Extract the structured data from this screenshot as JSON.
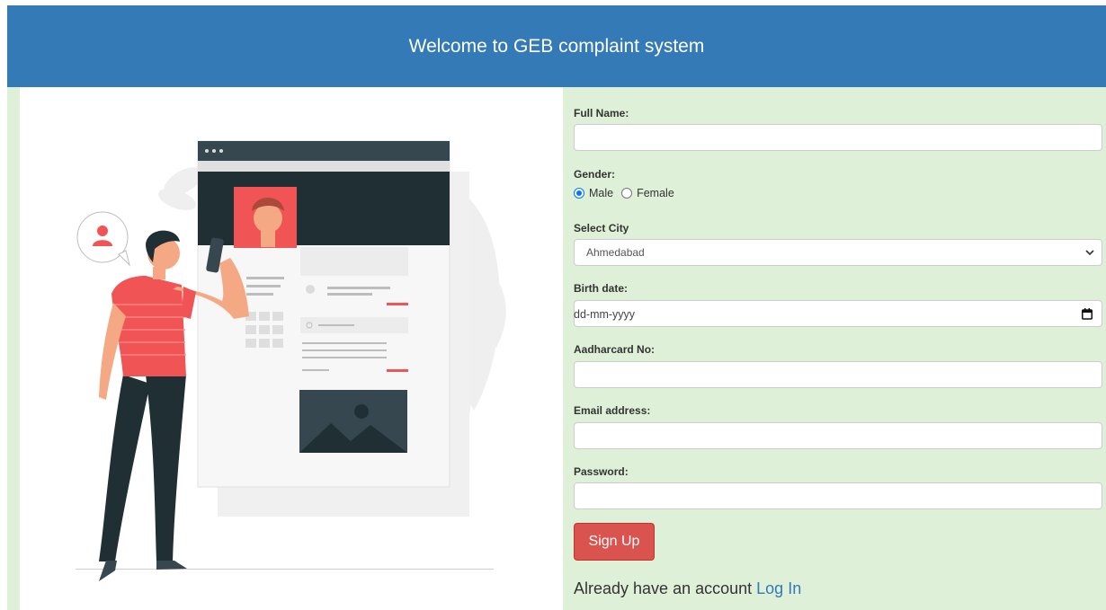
{
  "header": {
    "title": "Welcome to GEB complaint system"
  },
  "form": {
    "full_name": {
      "label": "Full Name:",
      "value": ""
    },
    "gender": {
      "label": "Gender:",
      "options": [
        "Male",
        "Female"
      ],
      "selected": "Male"
    },
    "city": {
      "label": "Select City",
      "selected": "Ahmedabad"
    },
    "birth_date": {
      "label": "Birth date:",
      "placeholder": "dd-mm-yyyy"
    },
    "aadhar": {
      "label": "Aadharcard No:",
      "value": ""
    },
    "email": {
      "label": "Email address:",
      "value": ""
    },
    "password": {
      "label": "Password:",
      "value": ""
    },
    "submit_label": "Sign Up"
  },
  "footer": {
    "prompt": "Already have an account",
    "link": "Log In"
  },
  "colors": {
    "header_bg": "#337ab7",
    "panel_bg": "#dff0d8",
    "button_bg": "#d9534f",
    "link": "#337ab7",
    "accent_red": "#f05454",
    "dark": "#1f2f33"
  }
}
